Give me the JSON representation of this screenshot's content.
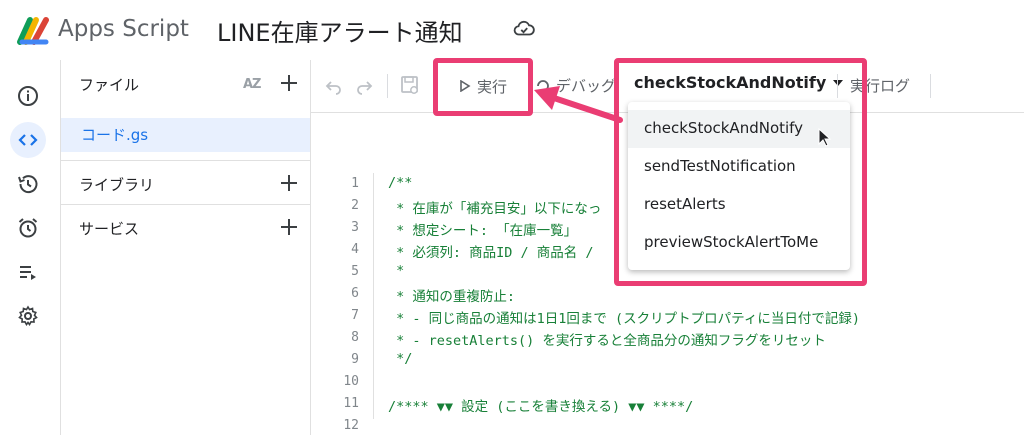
{
  "header": {
    "app_name": "Apps Script",
    "project_title": "LINE在庫アラート通知"
  },
  "rail": {
    "items": [
      "info-icon",
      "code-icon",
      "history-icon",
      "alarm-icon",
      "executions-icon",
      "settings-icon"
    ],
    "active": "code-icon"
  },
  "files_panel": {
    "files_label": "ファイル",
    "file_name": "コード.gs",
    "libraries_label": "ライブラリ",
    "services_label": "サービス",
    "sort_label": "AZ"
  },
  "toolbar": {
    "run_label": "実行",
    "debug_label": "デバッグ",
    "selected_function": "checkStockAndNotify",
    "log_label": "実行ログ"
  },
  "dropdown": {
    "options": [
      "checkStockAndNotify",
      "sendTestNotification",
      "resetAlerts",
      "previewStockAlertToMe"
    ],
    "hovered": "checkStockAndNotify"
  },
  "code": {
    "line_numbers": [
      "1",
      "2",
      "3",
      "4",
      "5",
      "6",
      "7",
      "8",
      "9",
      "10",
      "11",
      "12"
    ],
    "lines": [
      "/**",
      " * 在庫が「補充目安」以下になっ",
      " * 想定シート: 「在庫一覧」",
      " * 必須列: 商品ID / 商品名 / ",
      " *",
      " * 通知の重複防止:",
      " * - 同じ商品の通知は1日1回まで (スクリプトプロパティに当日付で記録)",
      " * - resetAlerts() を実行すると全商品分の通知フラグをリセット",
      " */",
      "",
      "/**** ▼▼ 設定 (ここを書き換える) ▼▼ ****/",
      ""
    ]
  },
  "colors": {
    "highlight": "#ea3d73",
    "accent": "#1a73e8",
    "code_comment": "#188038"
  }
}
